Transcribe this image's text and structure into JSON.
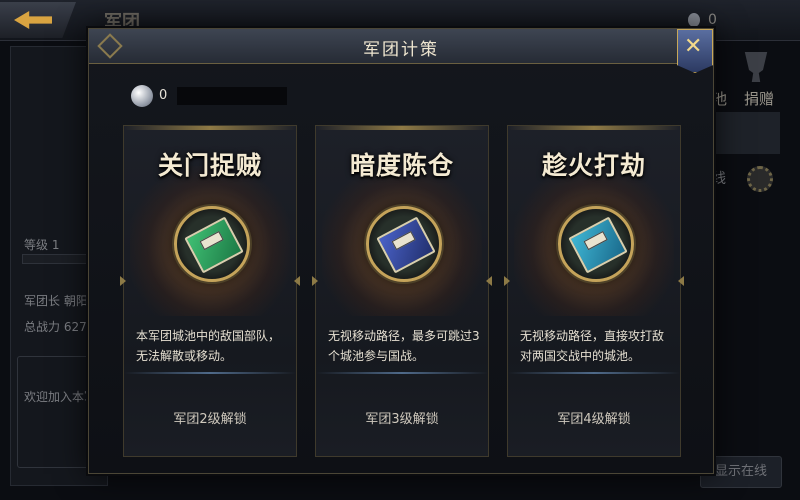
{
  "background": {
    "title": "军团",
    "currency_value": "0",
    "level_label": "等级 1",
    "leader_label": "军团长 朝阳",
    "power_label": "总战力 627",
    "welcome_text": "欢迎加入本军",
    "donate_label": "捐赠",
    "pool_label": "池",
    "line_label": "线",
    "online_button": "显示在线"
  },
  "modal": {
    "title": "军团计策",
    "resource_value": "0"
  },
  "cards": [
    {
      "title": "关门捉贼",
      "description": "本军团城池中的敌国部队，无法解散或移动。",
      "unlock": "军团2级解锁",
      "book_color": "green"
    },
    {
      "title": "暗度陈仓",
      "description": "无视移动路径，最多可跳过3个城池参与国战。",
      "unlock": "军团3级解锁",
      "book_color": "blue"
    },
    {
      "title": "趁火打劫",
      "description": "无视移动路径，直接攻打敌对两国交战中的城池。",
      "unlock": "军团4级解锁",
      "book_color": "cyan"
    }
  ]
}
